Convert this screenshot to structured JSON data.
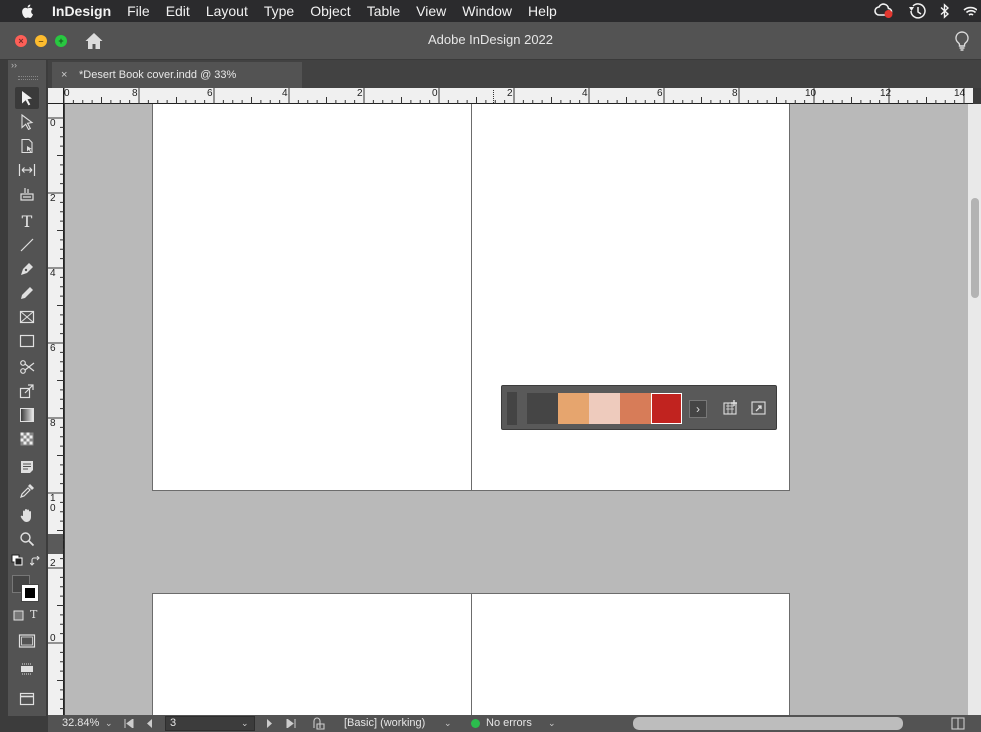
{
  "menubar": {
    "app_name": "InDesign",
    "items": [
      "File",
      "Edit",
      "Layout",
      "Type",
      "Object",
      "Table",
      "View",
      "Window",
      "Help"
    ],
    "status_icons": [
      "creative-cloud-icon",
      "time-machine-icon",
      "bluetooth-icon",
      "wifi-icon"
    ]
  },
  "window": {
    "title": "Adobe InDesign 2022"
  },
  "document": {
    "tab_label": "*Desert Book cover.indd @ 33%",
    "close_glyph": "×"
  },
  "rulers": {
    "horizontal_labels": [
      "0",
      "8",
      "6",
      "4",
      "2",
      "0",
      "2",
      "4",
      "6",
      "8",
      "10",
      "12",
      "14"
    ],
    "vertical_labels": [
      "0",
      "2",
      "4",
      "6",
      "8",
      "1",
      "0",
      "2",
      "0"
    ]
  },
  "tools": [
    "selection-tool",
    "direct-selection-tool",
    "page-tool",
    "gap-tool",
    "content-collector-tool",
    "type-tool",
    "line-tool",
    "pen-tool",
    "pencil-tool",
    "rectangle-frame-tool",
    "rectangle-tool",
    "scissors-tool",
    "free-transform-tool",
    "gradient-swatch-tool",
    "gradient-feather-tool",
    "note-tool",
    "eyedropper-tool",
    "hand-tool",
    "zoom-tool"
  ],
  "swatches": {
    "colors": [
      "#454545",
      "#e6a56e",
      "#eecbbd",
      "#d77c58",
      "#c1231f"
    ],
    "selected_index": 4,
    "next_glyph": "›"
  },
  "statusbar": {
    "zoom": "32.84%",
    "page_number": "3",
    "preflight_profile": "[Basic] (working)",
    "errors": "No errors"
  }
}
